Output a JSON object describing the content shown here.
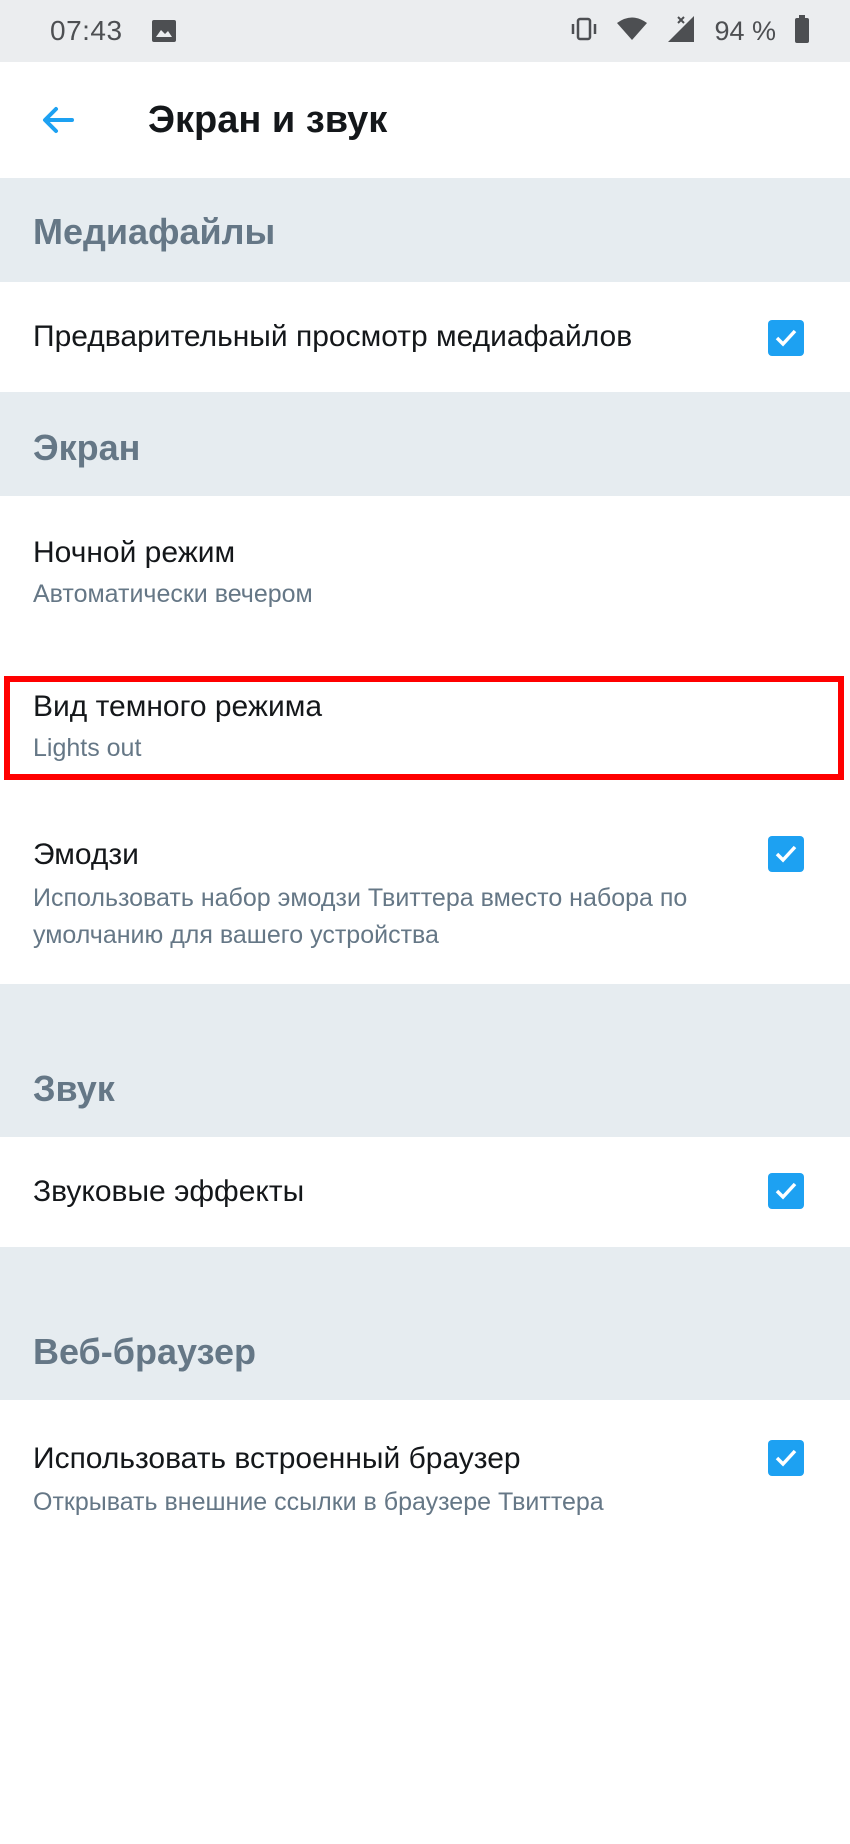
{
  "status_bar": {
    "time": "07:43",
    "battery": "94 %",
    "icons": [
      "image-icon",
      "vibrate-icon",
      "wifi-icon",
      "signal-icon",
      "battery-icon"
    ]
  },
  "app_bar": {
    "title": "Экран и звук",
    "back_icon": "arrow-left-icon"
  },
  "sections": {
    "media": {
      "header": "Медиафайлы",
      "items": [
        {
          "title": "Предварительный просмотр медиафайлов",
          "checked": true
        }
      ]
    },
    "screen": {
      "header": "Экран",
      "items": [
        {
          "title": "Ночной режим",
          "subtitle": "Автоматически вечером"
        },
        {
          "title": "Вид темного режима",
          "subtitle": "Lights out"
        },
        {
          "title": "Эмодзи",
          "subtitle": "Использовать набор эмодзи Твиттера вместо набора по умолчанию для вашего устройства",
          "checked": true
        }
      ]
    },
    "sound": {
      "header": "Звук",
      "items": [
        {
          "title": "Звуковые эффекты",
          "checked": true
        }
      ]
    },
    "browser": {
      "header": "Веб-браузер",
      "items": [
        {
          "title": "Использовать встроенный браузер",
          "subtitle": "Открывать внешние ссылки в браузере Твиттера",
          "checked": true
        }
      ]
    }
  },
  "colors": {
    "accent": "#1da1f2",
    "section_bg": "#e6ecf0",
    "section_text": "#657786",
    "highlight": "#ff0000"
  }
}
